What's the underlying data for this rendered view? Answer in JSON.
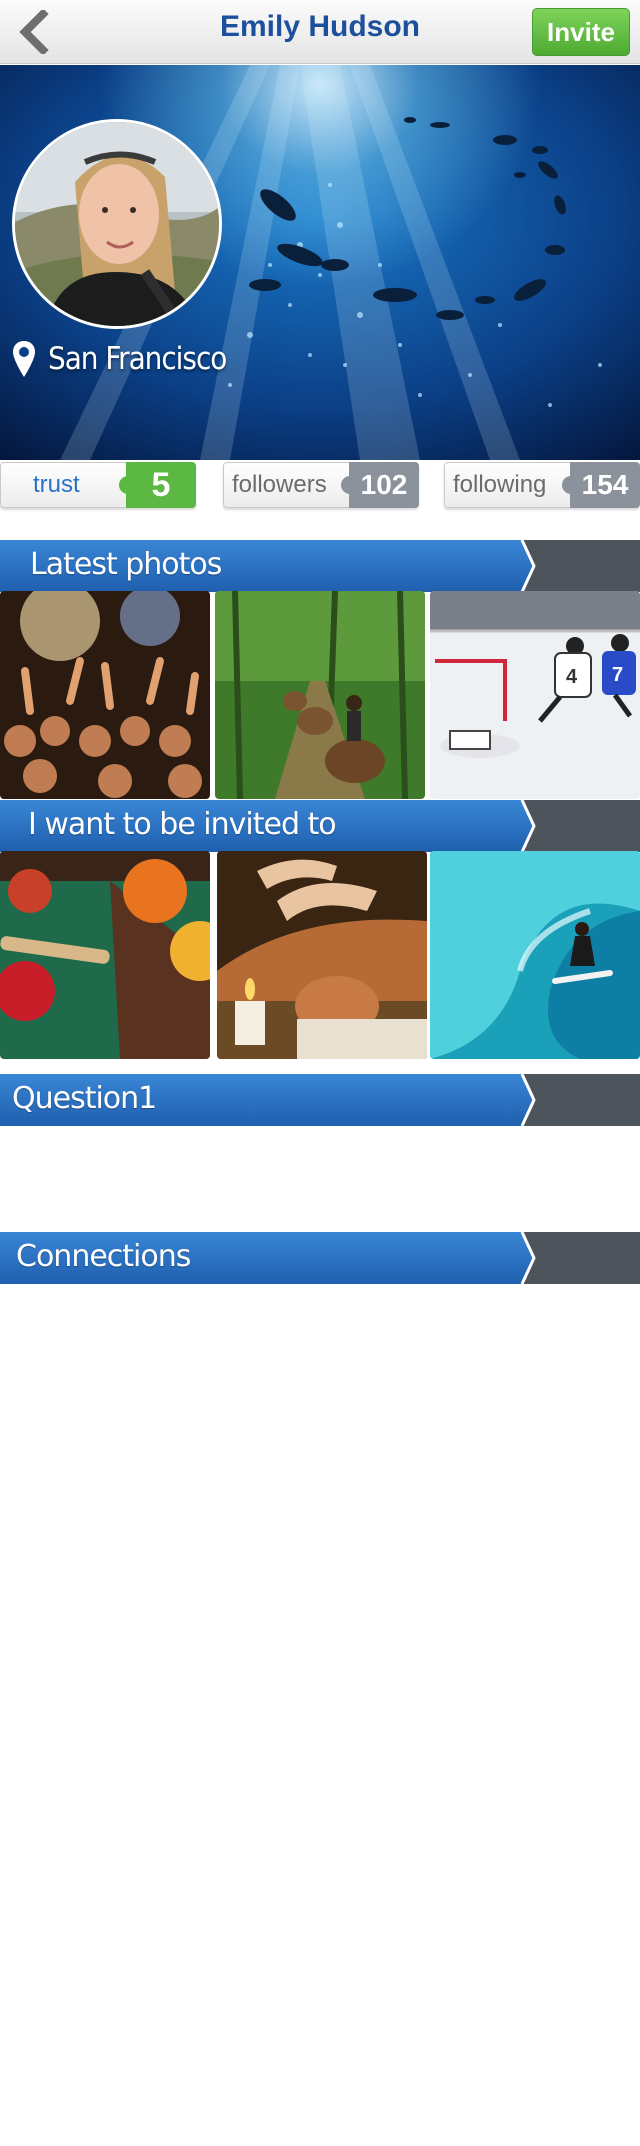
{
  "header": {
    "title": "Emily Hudson",
    "invite_label": "Invite",
    "back_icon": "chevron-left-icon"
  },
  "profile": {
    "location": "San Francisco",
    "location_icon": "map-pin-icon"
  },
  "stats": {
    "trust": {
      "label": "trust",
      "value": "5",
      "color": "#5bb842"
    },
    "followers": {
      "label": "followers",
      "value": "102",
      "color": "#8c929c"
    },
    "following": {
      "label": "following",
      "value": "154",
      "color": "#8c929c"
    }
  },
  "sections": {
    "latest_photos": "Latest photos",
    "invited_to": "I want to be invited to",
    "question": "Question1",
    "connections": "Connections"
  },
  "colors": {
    "accent_blue": "#1c4f9c",
    "section_blue": "#2a72c8",
    "section_dark": "#4e545c",
    "invite_green": "#5bb842"
  }
}
